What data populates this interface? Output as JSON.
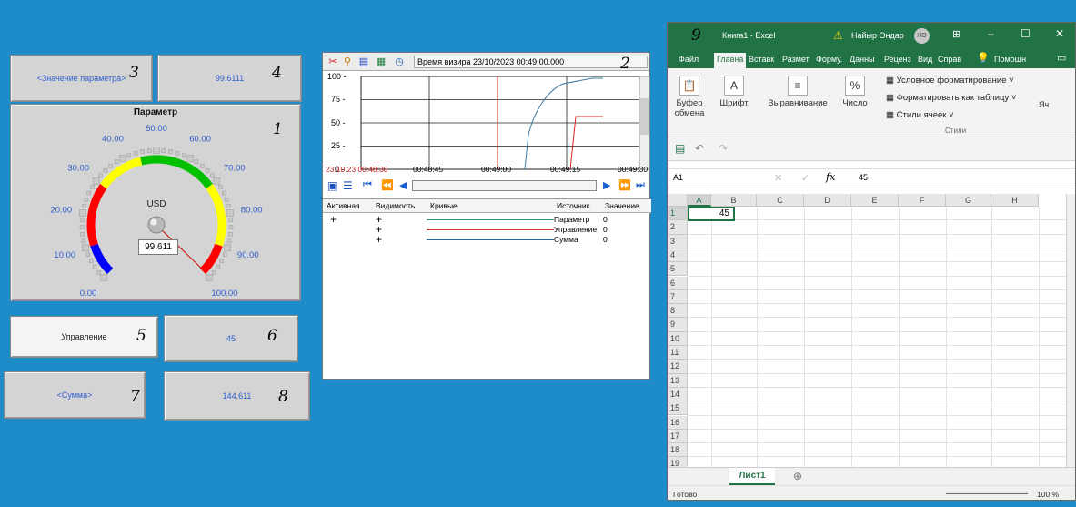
{
  "scada": {
    "param_name_label": "<Значение параметра>",
    "param_value": "99.6111",
    "gauge_title": "Параметр",
    "gauge_unit": "USD",
    "gauge_value": "99.611",
    "gauge_level": 99.611,
    "gauge_ticks": [
      "0.00",
      "10.00",
      "20.00",
      "30.00",
      "40.00",
      "50.00",
      "60.00",
      "70.00",
      "80.00",
      "90.00",
      "100.00"
    ],
    "control_label": "Управление",
    "control_value": "45",
    "sum_label": "<Сумма>",
    "sum_value": "144.611",
    "colors": {
      "low": "#0000ff",
      "mid": "#ff0000",
      "warn": "#ffff00",
      "ok": "#00c000",
      "needle": "#cc0000"
    }
  },
  "annotations": [
    "1",
    "2",
    "3",
    "4",
    "5",
    "6",
    "7",
    "8",
    "9"
  ],
  "trend": {
    "cursor_time": "Время визира 23/10/2023 00:49:00.000",
    "y_ticks": [
      "100 -",
      "75 -",
      "50 -",
      "25 -",
      "0 -"
    ],
    "x_ticks": [
      "23.10.23 00:48:30",
      "00:48:45",
      "00:49:00",
      "00:49:15",
      "00:49:30"
    ],
    "legend_headers": [
      "Активная",
      "Видимость",
      "Кривые",
      "Источник",
      "Значение"
    ],
    "legend_rows": [
      {
        "active": "+",
        "visible": "+",
        "source": "Параметр",
        "value": "0",
        "color": "#2a9a6a"
      },
      {
        "active": "",
        "visible": "+",
        "source": "Управление",
        "value": "0",
        "color": "#e03030"
      },
      {
        "active": "",
        "visible": "+",
        "source": "Сумма",
        "value": "0",
        "color": "#2a6a9a"
      }
    ]
  },
  "excel": {
    "title": "Книга1 - Excel",
    "user": "Найыр Ондар",
    "user_initials": "НО",
    "tabs": [
      "Файл",
      "Главна",
      "Вставк",
      "Размет",
      "Форму.",
      "Данны",
      "Реценз",
      "Вид",
      "Справ"
    ],
    "help": "Помощн",
    "ribbon": {
      "clipboard": "Буфер обмена",
      "font": "Шрифт",
      "align": "Выравнивание",
      "number": "Число",
      "cond_format": "Условное форматирование",
      "format_table": "Форматировать как таблицу",
      "cell_styles": "Стили ячеек",
      "styles_group": "Стили",
      "cells_short": "Яч"
    },
    "name_box": "A1",
    "formula_value": "45",
    "columns": [
      "A",
      "B",
      "C",
      "D",
      "E",
      "F",
      "G",
      "H"
    ],
    "rows": [
      "1",
      "2",
      "3",
      "4",
      "5",
      "6",
      "7",
      "8",
      "9",
      "10",
      "11",
      "12",
      "13",
      "14",
      "15",
      "16",
      "17",
      "18",
      "19"
    ],
    "cell_a1": "45",
    "sheet_tab": "Лист1",
    "status": "Готово",
    "zoom": "100 %"
  }
}
